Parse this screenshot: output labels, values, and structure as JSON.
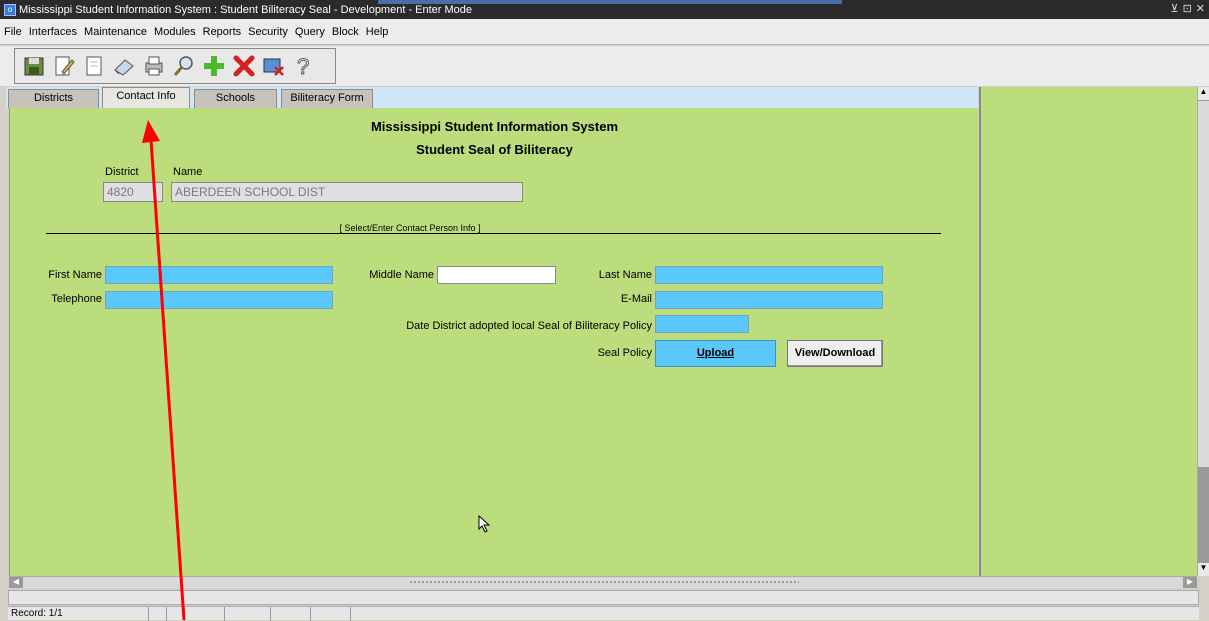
{
  "window": {
    "title": "Mississippi Student Information System : Student Biliteracy Seal  -  Development  -  Enter Mode",
    "controls": [
      "⊻",
      "⊡",
      "✕"
    ]
  },
  "menu": [
    "File",
    "Interfaces",
    "Maintenance",
    "Modules",
    "Reports",
    "Security",
    "Query",
    "Block",
    "Help"
  ],
  "toolbar": {
    "icons": [
      "save-icon",
      "edit-icon",
      "blank-page-icon",
      "eraser-icon",
      "print-icon",
      "search-icon",
      "add-icon",
      "delete-icon",
      "exit-icon",
      "help-icon"
    ]
  },
  "tabs": [
    {
      "label": "Districts",
      "active": false
    },
    {
      "label": "Contact Info",
      "active": true
    },
    {
      "label": "Schools",
      "active": false
    },
    {
      "label": "Biliteracy Form",
      "active": false
    }
  ],
  "form": {
    "heading1": "Mississippi Student Information System",
    "heading2": "Student Seal of Biliteracy",
    "district_label": "District",
    "name_label": "Name",
    "district_value": "4820",
    "name_value": "ABERDEEN SCHOOL DIST",
    "section_caption": "[ Select/Enter Contact Person Info ]",
    "first_name_label": "First Name",
    "middle_name_label": "Middle Name",
    "last_name_label": "Last Name",
    "telephone_label": "Telephone",
    "email_label": "E-Mail",
    "date_adopted_label": "Date District adopted local Seal of Biliteracy Policy",
    "seal_policy_label": "Seal Policy",
    "upload_label": "Upload",
    "view_download_label": "View/Download"
  },
  "status": {
    "record": "Record: 1/1"
  },
  "colors": {
    "form_bg": "#bcdd7c",
    "field_bg": "#5ac8fa",
    "annotation_arrow": "#ff0000"
  }
}
